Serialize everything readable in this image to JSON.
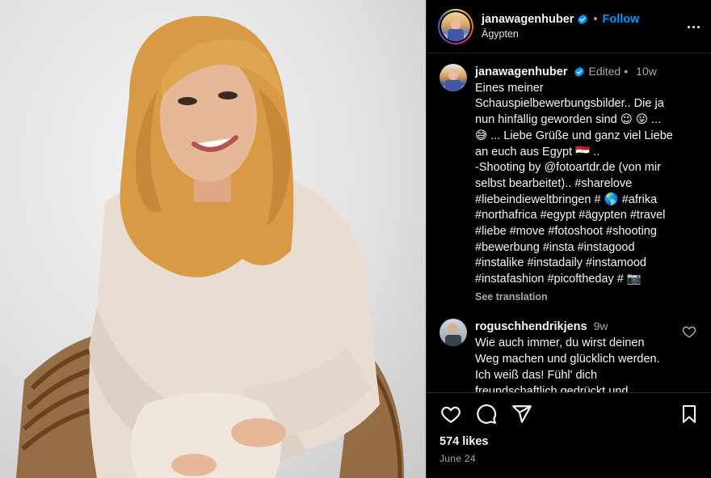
{
  "photo": {
    "description_icon": "portrait-photo"
  },
  "header": {
    "username": "janawagenhuber",
    "separator": "•",
    "follow_label": "Follow",
    "location": "Ägypten",
    "more_icon": "more-horizontal-icon"
  },
  "caption": {
    "username": "janawagenhuber",
    "edited": "Edited",
    "separator": "•",
    "age": "10w",
    "text": "Eines meiner\nSchauspielbewerbungsbilder.. Die ja\nnun hinfällig geworden sind 😉 😛 ...\n😅 ... Liebe Grüße und ganz viel Liebe\nan euch aus Egypt 🇪🇬 ..\n-Shooting by @fotoartdr.de (von mir\nselbst bearbeitet).. #sharelove\n#liebeindieweltbringen # 🌎 #afrika\n#northafrica #egypt #ägypten #travel\n#liebe #move #fotoshoot #shooting\n#bewerbung #insta #instagood\n#instalike #instadaily #instamood\n#instafashion #picoftheday # 📷",
    "see_translation": "See translation"
  },
  "comment": {
    "username": "roguschhendrikjens",
    "age": "9w",
    "text": "Wie auch immer, du wirst deinen\nWeg machen und glücklich werden.\nIch weiß das! Fühl' dich\nfreundschaftlich gedrückt und"
  },
  "actions": {
    "like_icon": "heart-icon",
    "comment_icon": "comment-icon",
    "share_icon": "share-icon",
    "save_icon": "bookmark-icon"
  },
  "likes": "574 likes",
  "date": "June 24",
  "colors": {
    "accent": "#0095f6",
    "background": "#000000",
    "muted": "#a8a8a8"
  }
}
